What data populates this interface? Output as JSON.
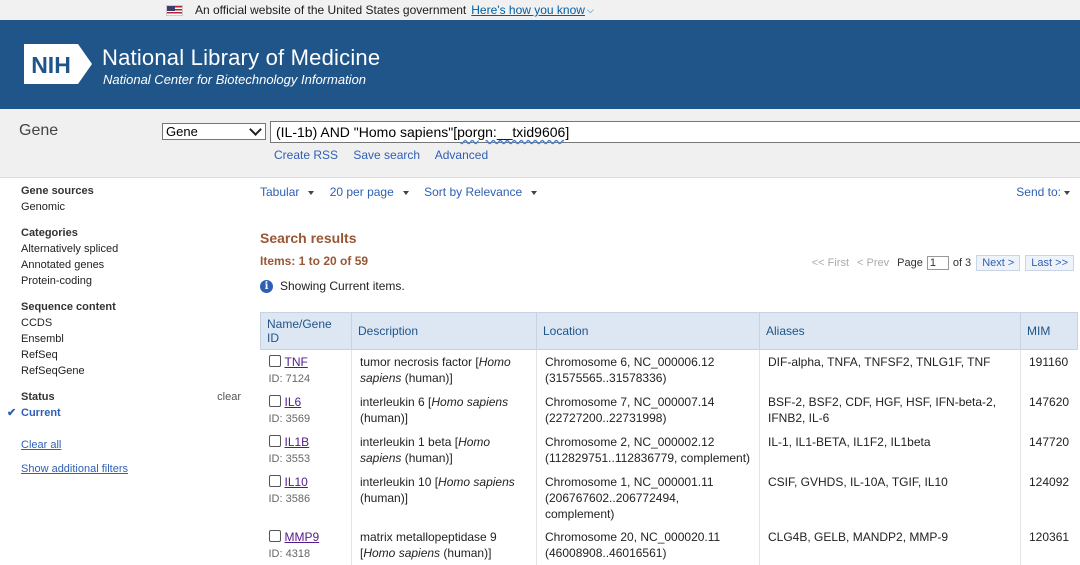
{
  "gov_banner": {
    "text": "An official website of the United States government",
    "link": "Here's how you know"
  },
  "header": {
    "logo_text": "NIH",
    "org_name": "National Library of Medicine",
    "org_sub": "National Center for Biotechnology Information"
  },
  "search": {
    "db_title": "Gene",
    "db_selected": "Gene",
    "term_before": "(IL-1b) AND \"Homo sapiens\"",
    "term_squiggle": "[porgn:__txid9606]",
    "links": [
      "Create RSS",
      "Save search",
      "Advanced"
    ]
  },
  "sidebar": {
    "gene_sources": {
      "title": "Gene sources",
      "items": [
        "Genomic"
      ]
    },
    "categories": {
      "title": "Categories",
      "items": [
        "Alternatively spliced",
        "Annotated genes",
        "Protein-coding"
      ]
    },
    "sequence_content": {
      "title": "Sequence content",
      "items": [
        "CCDS",
        "Ensembl",
        "RefSeq",
        "RefSeqGene"
      ]
    },
    "status": {
      "title": "Status",
      "clear": "clear",
      "current": "Current"
    },
    "clear_all": "Clear all",
    "show_filters": "Show additional filters"
  },
  "toolbar": {
    "format": "Tabular",
    "per_page": "20 per page",
    "sort": "Sort by Relevance",
    "send_to": "Send to:"
  },
  "results": {
    "title": "Search results",
    "items_count": "Items: 1 to 20 of 59",
    "info": "Showing Current items."
  },
  "pager": {
    "first": "<< First",
    "prev": "< Prev",
    "page_label": "Page",
    "page_value": "1",
    "of_label": "of 3",
    "next": "Next >",
    "last": "Last >>"
  },
  "table": {
    "headers": [
      "Name/Gene ID",
      "Description",
      "Location",
      "Aliases",
      "MIM"
    ],
    "rows": [
      {
        "name": "TNF",
        "id": "ID: 7124",
        "desc_a": "tumor necrosis factor [",
        "desc_it": "Homo sapiens",
        "desc_b": " (human)]",
        "loc1": "Chromosome 6, NC_000006.12",
        "loc2": "(31575565..31578336)",
        "aliases": "DIF-alpha, TNFA, TNFSF2, TNLG1F, TNF",
        "mim": "191160"
      },
      {
        "name": "IL6",
        "id": "ID: 3569",
        "desc_a": "interleukin 6 [",
        "desc_it": "Homo sapiens",
        "desc_b": " (human)]",
        "loc1": "Chromosome 7, NC_000007.14",
        "loc2": "(22727200..22731998)",
        "aliases": "BSF-2, BSF2, CDF, HGF, HSF, IFN-beta-2, IFNB2, IL-6",
        "mim": "147620"
      },
      {
        "name": "IL1B",
        "id": "ID: 3553",
        "desc_a": "interleukin 1 beta [",
        "desc_it": "Homo sapiens",
        "desc_b": " (human)]",
        "loc1": "Chromosome 2, NC_000002.12",
        "loc2": "(112829751..112836779, complement)",
        "aliases": "IL-1, IL1-BETA, IL1F2, IL1beta",
        "mim": "147720"
      },
      {
        "name": "IL10",
        "id": "ID: 3586",
        "desc_a": "interleukin 10 [",
        "desc_it": "Homo sapiens",
        "desc_b": " (human)]",
        "loc1": "Chromosome 1, NC_000001.11",
        "loc2": "(206767602..206772494, complement)",
        "aliases": "CSIF, GVHDS, IL-10A, TGIF, IL10",
        "mim": "124092"
      },
      {
        "name": "MMP9",
        "id": "ID: 4318",
        "desc_a": "matrix metallopeptidase 9 [",
        "desc_it": "Homo sapiens",
        "desc_b": " (human)]",
        "loc1": "Chromosome 20, NC_000020.11",
        "loc2": "(46008908..46016561)",
        "aliases": "CLG4B, GELB, MANDP2, MMP-9",
        "mim": "120361"
      }
    ]
  }
}
